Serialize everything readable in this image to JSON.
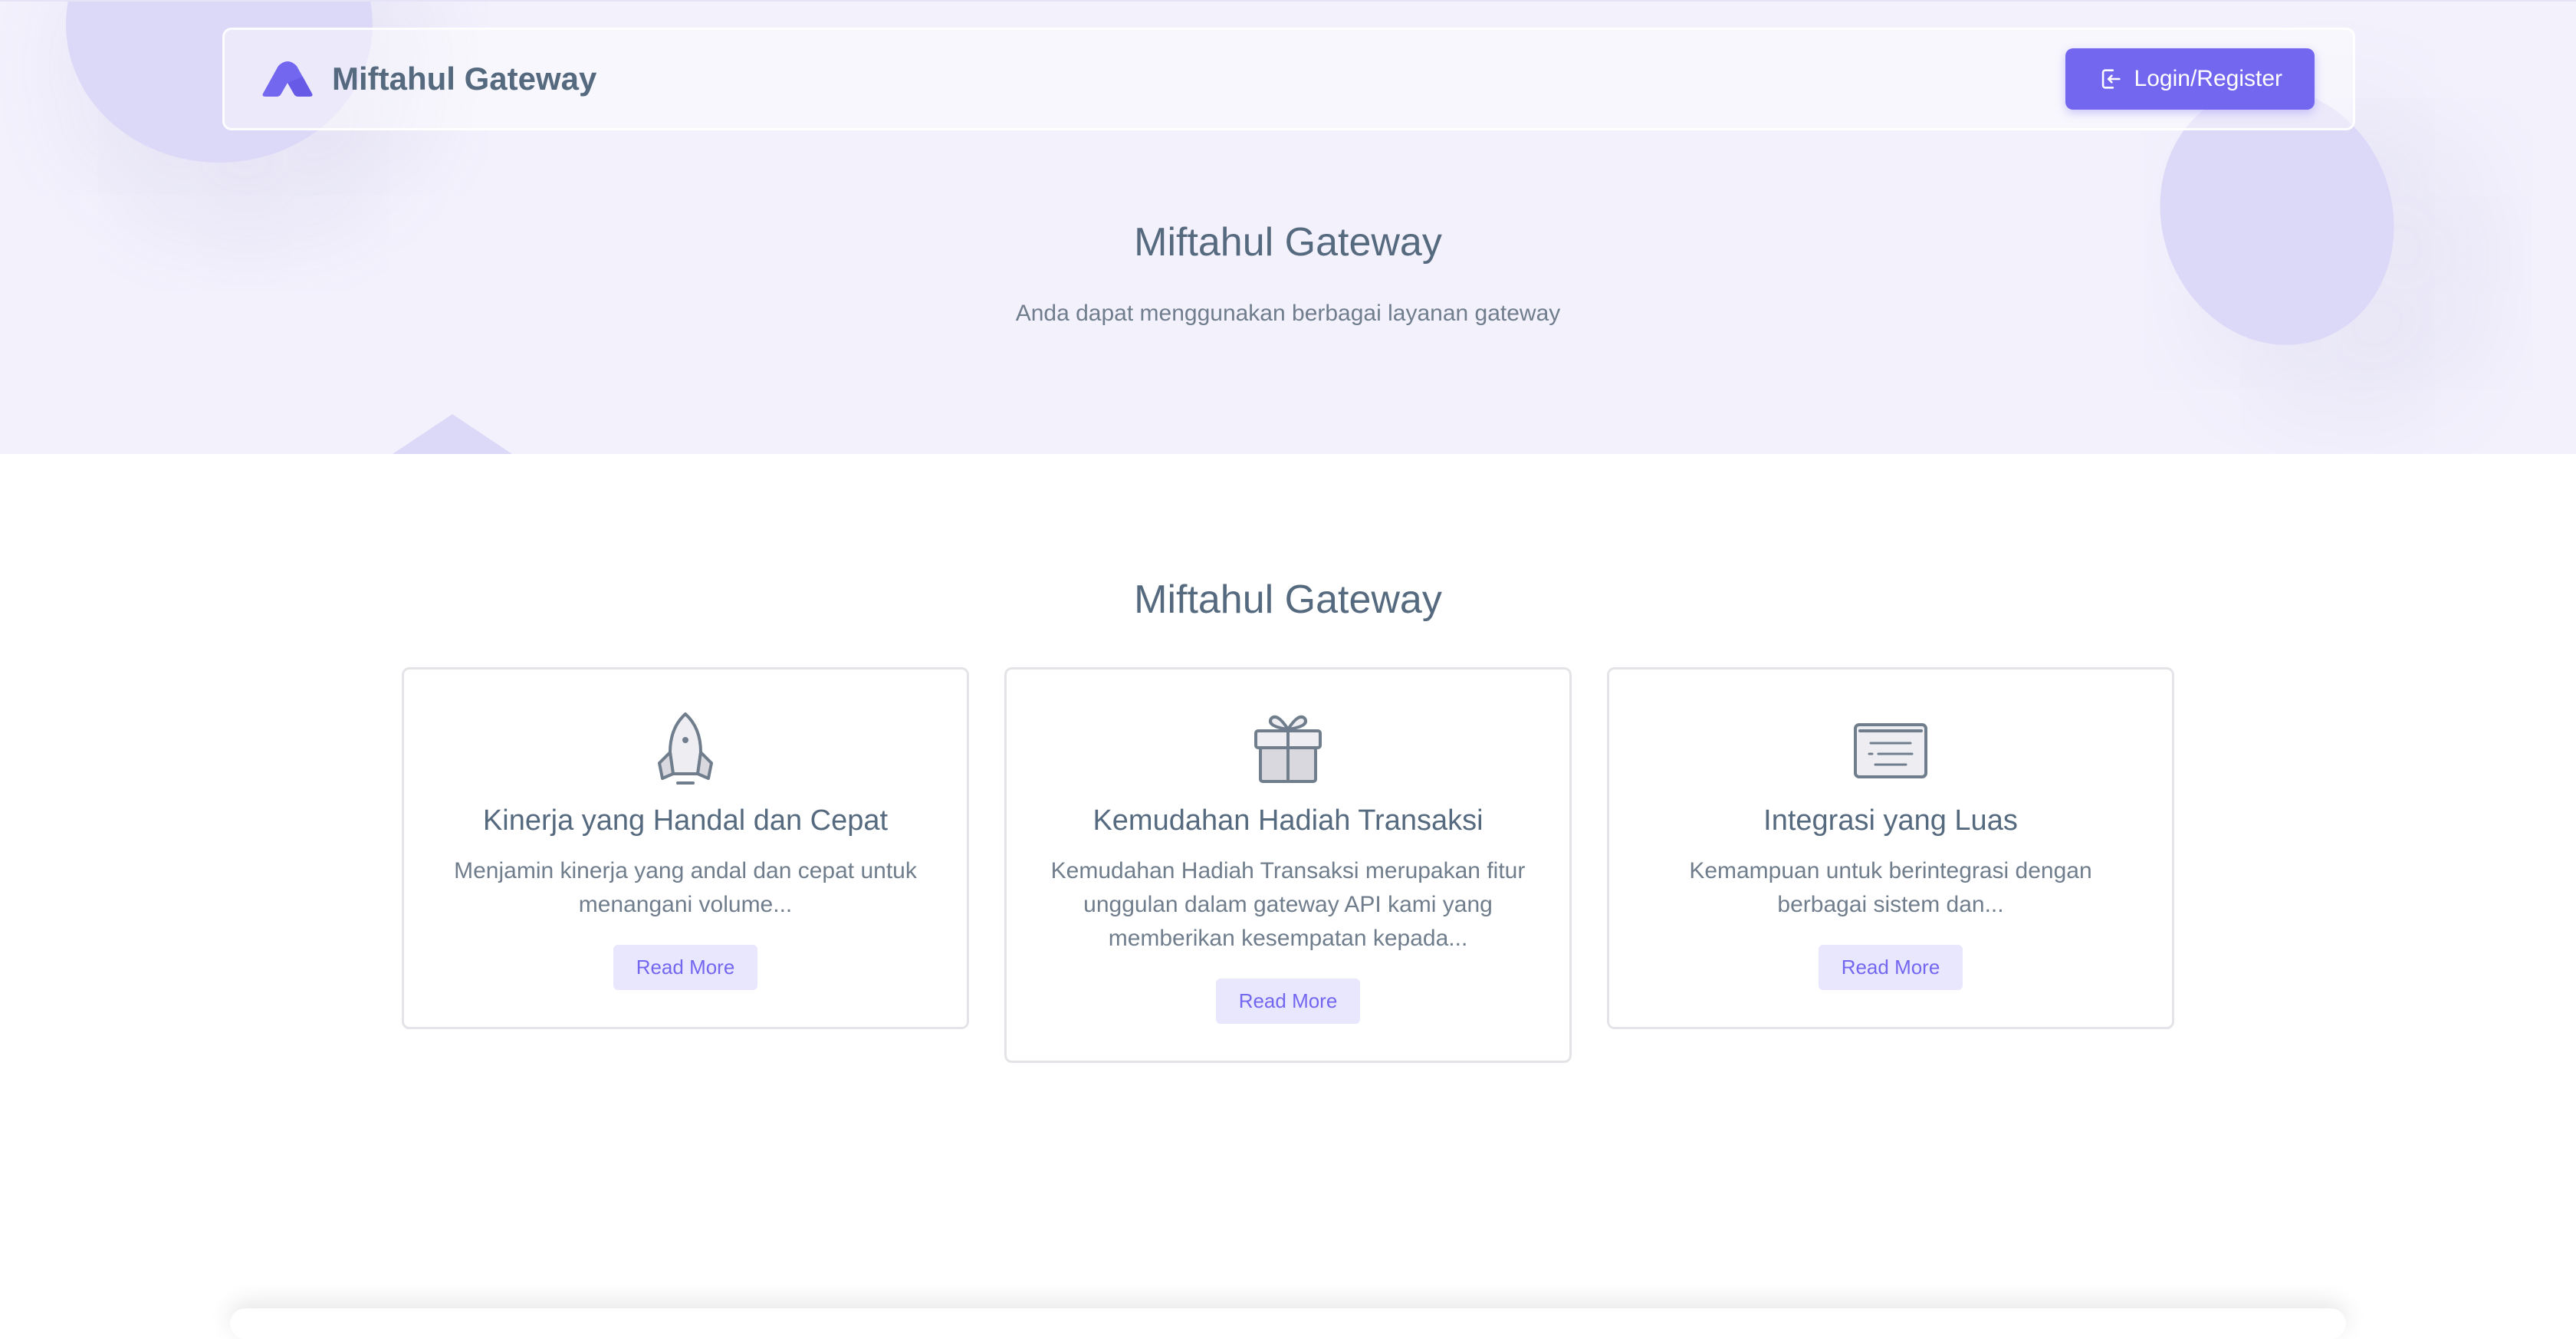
{
  "navbar": {
    "brand_name": "Miftahul Gateway",
    "login_label": "Login/Register"
  },
  "hero": {
    "title": "Miftahul Gateway",
    "subtitle": "Anda dapat menggunakan berbagai layanan gateway"
  },
  "features": {
    "title": "Miftahul Gateway",
    "cards": [
      {
        "icon": "rocket-icon",
        "title": "Kinerja yang Handal dan Cepat",
        "text": "Menjamin kinerja yang andal dan cepat untuk menangani volume...",
        "button": "Read More"
      },
      {
        "icon": "gift-icon",
        "title": "Kemudahan Hadiah Transaksi",
        "text": "Kemudahan Hadiah Transaksi merupakan fitur unggulan dalam gateway API kami yang memberikan kesempatan kepada...",
        "button": "Read More"
      },
      {
        "icon": "keyboard-icon",
        "title": "Integrasi yang Luas",
        "text": "Kemampuan untuk berintegrasi dengan berbagai sistem dan...",
        "button": "Read More"
      }
    ]
  },
  "colors": {
    "primary": "#7367f0",
    "primary_light": "#e9e7fd",
    "hero_background": "#f3f1fc",
    "text": "#566a7f"
  }
}
